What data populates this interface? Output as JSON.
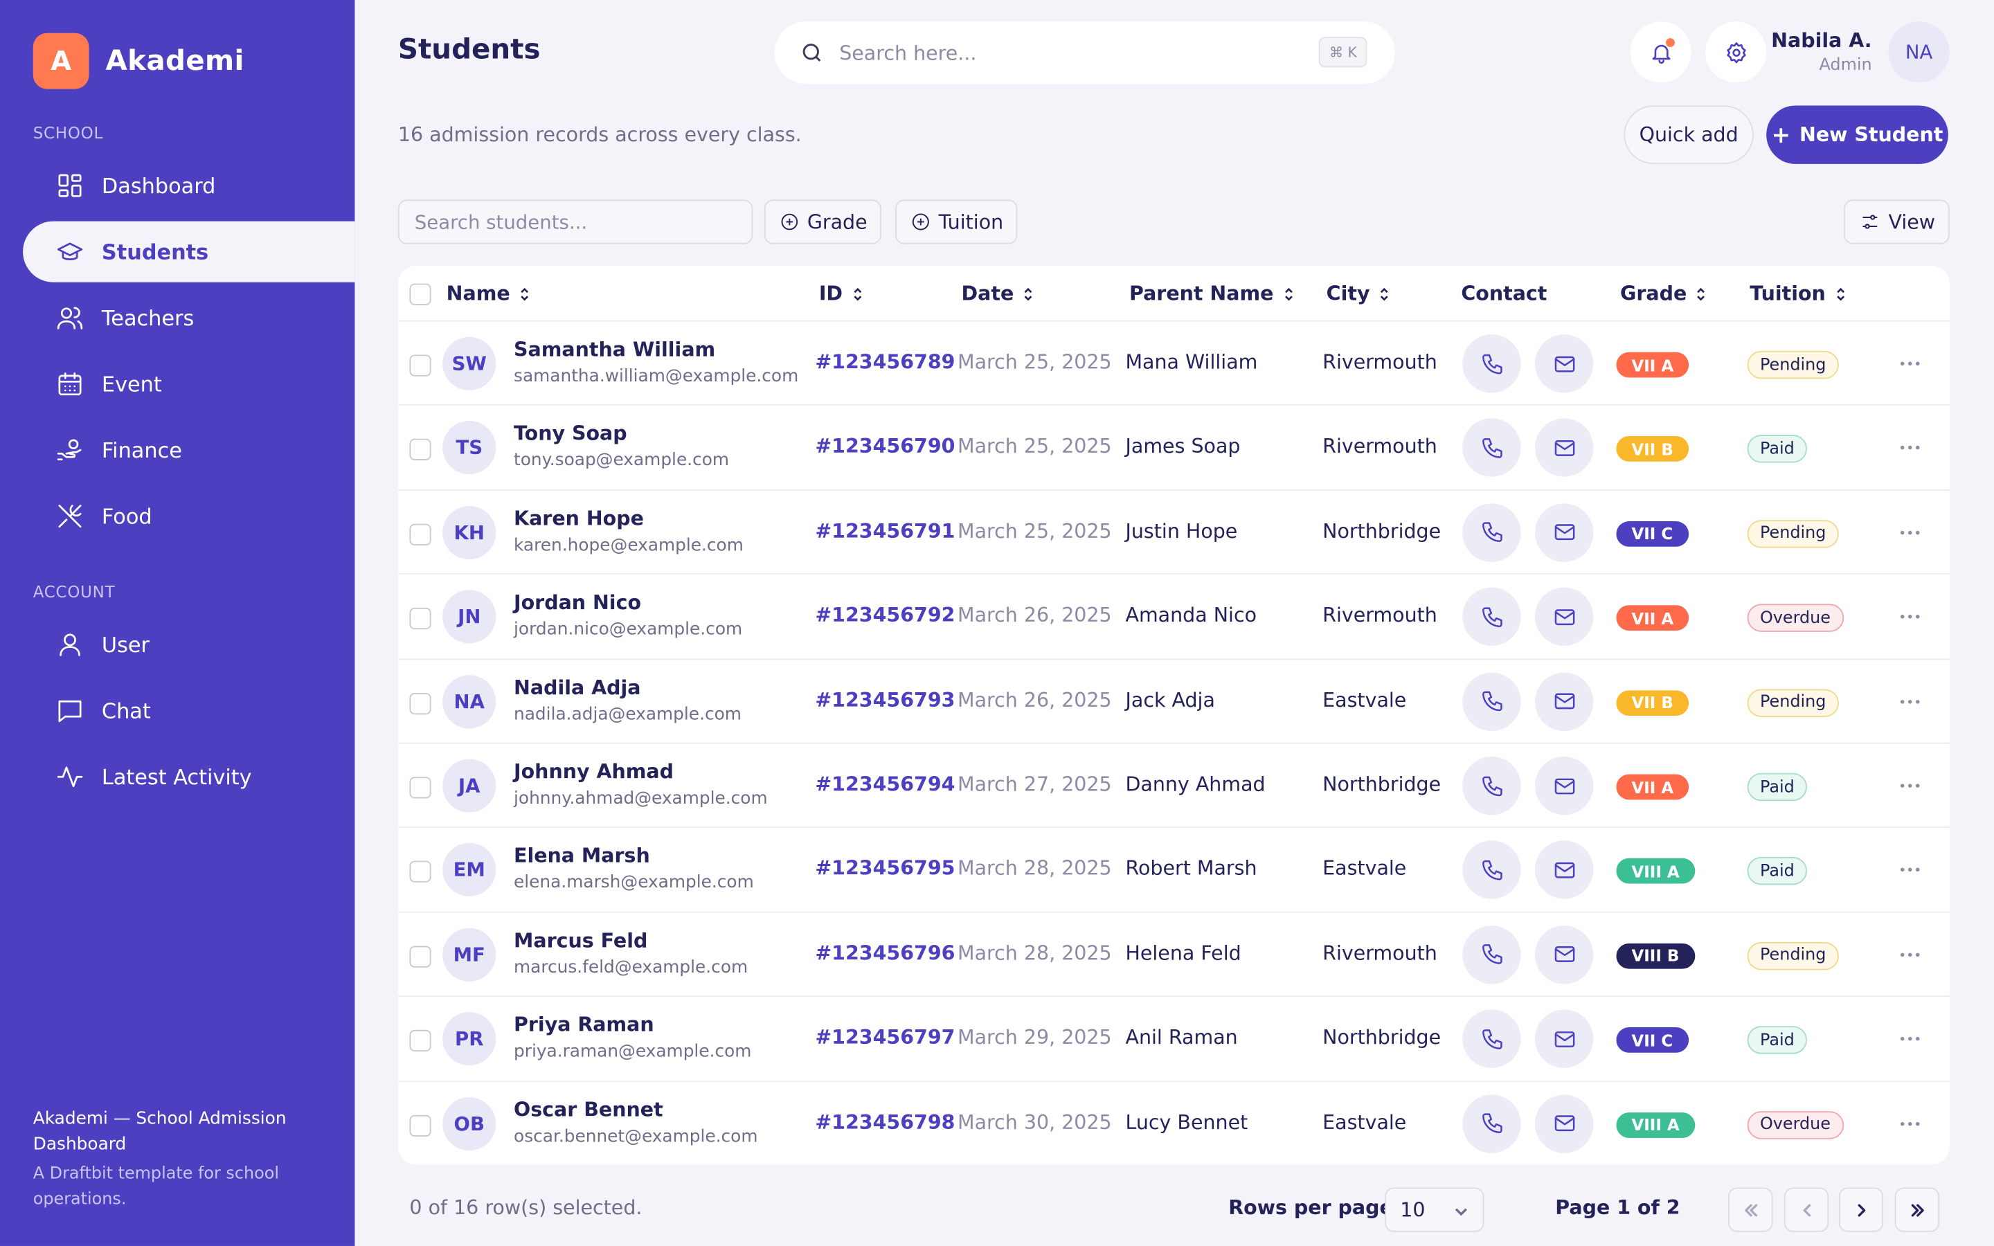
{
  "brand": {
    "logo_letter": "A",
    "name": "Akademi"
  },
  "sidebar": {
    "school_title": "SCHOOL",
    "school_items": [
      {
        "label": "Dashboard",
        "icon": "dashboard-icon"
      },
      {
        "label": "Students",
        "icon": "graduation-cap-icon",
        "active": true
      },
      {
        "label": "Teachers",
        "icon": "users-icon"
      },
      {
        "label": "Event",
        "icon": "calendar-icon"
      },
      {
        "label": "Finance",
        "icon": "hand-coins-icon"
      },
      {
        "label": "Food",
        "icon": "utensils-icon"
      }
    ],
    "account_title": "ACCOUNT",
    "account_items": [
      {
        "label": "User",
        "icon": "user-icon"
      },
      {
        "label": "Chat",
        "icon": "chat-icon"
      },
      {
        "label": "Latest Activity",
        "icon": "activity-icon"
      }
    ],
    "footer_title": "Akademi — School Admission Dashboard",
    "footer_sub": "A Draftbit template for school operations."
  },
  "header": {
    "title": "Students",
    "search_placeholder": "Search here...",
    "shortcut": "⌘ K",
    "user_name": "Nabila A.",
    "user_role": "Admin",
    "user_initials": "NA"
  },
  "page": {
    "subtitle": "16 admission records across every class.",
    "quick_add_label": "Quick add",
    "new_student_label": "New Student",
    "filter_placeholder": "Search students...",
    "grade_filter_label": "Grade",
    "tuition_filter_label": "Tuition",
    "view_label": "View"
  },
  "table": {
    "columns": {
      "name": "Name",
      "id": "ID",
      "date": "Date",
      "parent": "Parent Name",
      "city": "City",
      "contact": "Contact",
      "grade": "Grade",
      "tuition": "Tuition"
    },
    "rows": [
      {
        "initials": "SW",
        "name": "Samantha William",
        "email": "samantha.william@example.com",
        "id": "#123456789",
        "date": "March 25, 2025",
        "parent": "Mana William",
        "city": "Rivermouth",
        "grade": "VII A",
        "tuition": "Pending"
      },
      {
        "initials": "TS",
        "name": "Tony Soap",
        "email": "tony.soap@example.com",
        "id": "#123456790",
        "date": "March 25, 2025",
        "parent": "James Soap",
        "city": "Rivermouth",
        "grade": "VII B",
        "tuition": "Paid"
      },
      {
        "initials": "KH",
        "name": "Karen Hope",
        "email": "karen.hope@example.com",
        "id": "#123456791",
        "date": "March 25, 2025",
        "parent": "Justin Hope",
        "city": "Northbridge",
        "grade": "VII C",
        "tuition": "Pending"
      },
      {
        "initials": "JN",
        "name": "Jordan Nico",
        "email": "jordan.nico@example.com",
        "id": "#123456792",
        "date": "March 26, 2025",
        "parent": "Amanda Nico",
        "city": "Rivermouth",
        "grade": "VII A",
        "tuition": "Overdue"
      },
      {
        "initials": "NA",
        "name": "Nadila Adja",
        "email": "nadila.adja@example.com",
        "id": "#123456793",
        "date": "March 26, 2025",
        "parent": "Jack Adja",
        "city": "Eastvale",
        "grade": "VII B",
        "tuition": "Pending"
      },
      {
        "initials": "JA",
        "name": "Johnny Ahmad",
        "email": "johnny.ahmad@example.com",
        "id": "#123456794",
        "date": "March 27, 2025",
        "parent": "Danny Ahmad",
        "city": "Northbridge",
        "grade": "VII A",
        "tuition": "Paid"
      },
      {
        "initials": "EM",
        "name": "Elena Marsh",
        "email": "elena.marsh@example.com",
        "id": "#123456795",
        "date": "March 28, 2025",
        "parent": "Robert Marsh",
        "city": "Eastvale",
        "grade": "VIII A",
        "tuition": "Paid"
      },
      {
        "initials": "MF",
        "name": "Marcus Feld",
        "email": "marcus.feld@example.com",
        "id": "#123456796",
        "date": "March 28, 2025",
        "parent": "Helena Feld",
        "city": "Rivermouth",
        "grade": "VIII B",
        "tuition": "Pending"
      },
      {
        "initials": "PR",
        "name": "Priya Raman",
        "email": "priya.raman@example.com",
        "id": "#123456797",
        "date": "March 29, 2025",
        "parent": "Anil Raman",
        "city": "Northbridge",
        "grade": "VII C",
        "tuition": "Paid"
      },
      {
        "initials": "OB",
        "name": "Oscar Bennet",
        "email": "oscar.bennet@example.com",
        "id": "#123456798",
        "date": "March 30, 2025",
        "parent": "Lucy Bennet",
        "city": "Eastvale",
        "grade": "VIII A",
        "tuition": "Overdue"
      }
    ]
  },
  "grade_colors": {
    "VII A": "#ff6b4a",
    "VII B": "#f8b82a",
    "VII C": "#4c3fc0",
    "VIII A": "#3dbf96",
    "VIII B": "#23235a"
  },
  "footer": {
    "selected_text": "0 of 16 row(s) selected.",
    "rows_per_page_label": "Rows per page",
    "rows_per_page_value": "10",
    "page_info": "Page 1 of 2"
  },
  "colors": {
    "accent": "#4c3fc0",
    "sidebar_bg": "#4c3fc0",
    "logo": "#ff7a50",
    "page_bg": "#f3f3f9"
  }
}
